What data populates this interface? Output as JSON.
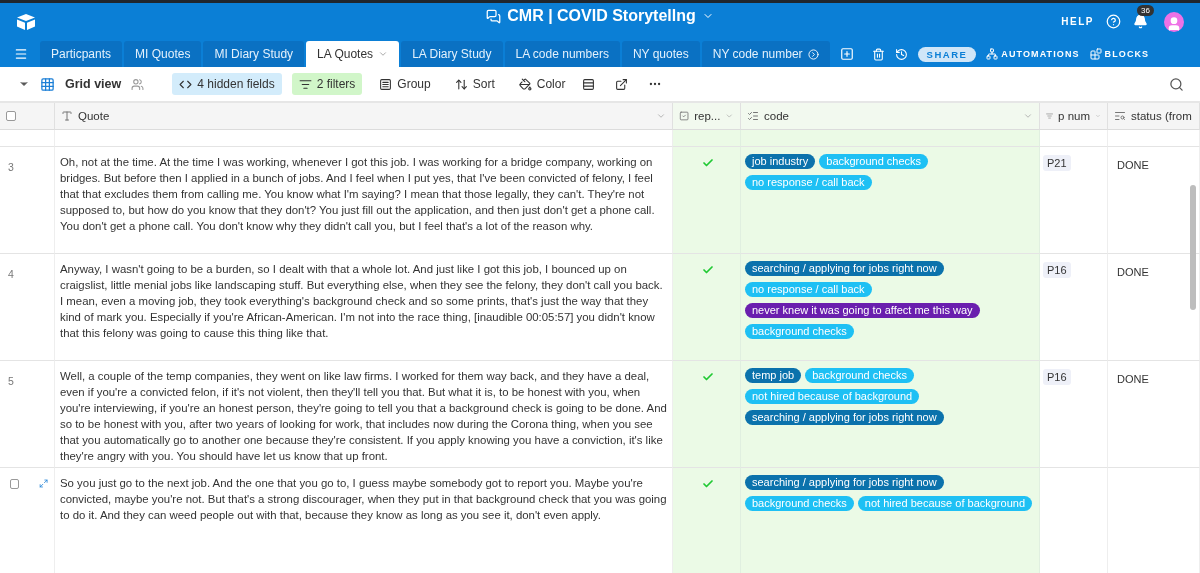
{
  "app_bar": {
    "title": "CMR | COVID Storytellng",
    "help": "HELP",
    "notifications": "36"
  },
  "tabs": [
    {
      "label": "Particpants",
      "selected": false
    },
    {
      "label": "MI Quotes",
      "selected": false
    },
    {
      "label": "MI Diary Study",
      "selected": false
    },
    {
      "label": "LA Quotes",
      "selected": true
    },
    {
      "label": "LA Diary Study",
      "selected": false
    },
    {
      "label": "LA code numbers",
      "selected": false
    },
    {
      "label": "NY quotes",
      "selected": false
    },
    {
      "label": "NY code number",
      "selected": false
    }
  ],
  "tab_actions": {
    "share": "SHARE",
    "automations": "AUTOMATIONS",
    "blocks": "BLOCKS"
  },
  "toolbar": {
    "view": "Grid view",
    "hidden_fields": "4 hidden fields",
    "filters": "2 filters",
    "group": "Group",
    "sort": "Sort",
    "color_label": "Color"
  },
  "table": {
    "select_all_checked": false,
    "columns": [
      {
        "label": "Quote",
        "kind": "text"
      },
      {
        "label": "rep...",
        "kind": "checkbox"
      },
      {
        "label": "code",
        "kind": "multi"
      },
      {
        "label": "p num",
        "kind": "link"
      },
      {
        "label": "status (from",
        "kind": "lookup"
      }
    ],
    "rows": [
      {
        "number": "3",
        "hovered": false,
        "quote": "Oh, not at the time. At the time I was working, whenever I got this job. I was working for a bridge company, working on bridges. But before then I applied in a bunch of jobs. And I feel when I put yes, that I've been convicted of felony, I feel that that excludes them from calling me. You know what I'm saying? I mean that those legally, they can't. They're not supposed to, but how do you know that they don't? You just fill out the application, and then just don't get a phone call. You don't get a phone call. You don't know why they didn't call you, but I feel that's a lot of the reason why.",
        "rep": true,
        "codes": [
          {
            "label": "job industry",
            "color": "#0b72ac"
          },
          {
            "label": "background checks",
            "color": "#1ec0f4"
          },
          {
            "label": "no response / call back",
            "color": "#1ec0f4"
          }
        ],
        "p_num": "P21",
        "status": "DONE"
      },
      {
        "number": "4",
        "hovered": false,
        "quote": "Anyway, I wasn't going to be a burden, so I dealt with that a whole lot. And just like I got this job, I bounced up on craigslist, little menial jobs like landscaping stuff. But everything else, when they see the felony, they don't call you back. I mean, even a moving job, they took everything's background check and so some prints, that's just the way that they kind of mark you. Especially if you're African-American. I'm not into the race thing, [inaudible 00:05:57] you didn't know that this felony was going to cause this thing like that.",
        "rep": true,
        "codes": [
          {
            "label": "searching / applying for jobs right now",
            "color": "#0b72ac"
          },
          {
            "label": "no response / call back",
            "color": "#1ec0f4"
          },
          {
            "label": "never knew it was going to affect me this way",
            "color": "#6a1fae"
          },
          {
            "label": "background checks",
            "color": "#1ec0f4"
          }
        ],
        "p_num": "P16",
        "status": "DONE"
      },
      {
        "number": "5",
        "hovered": false,
        "quote": "Well, a couple of the temp companies, they went on like law firms. I worked for them way back, and they have a deal, even if you're a convicted felon, if it's not violent, then they'll tell you that. But what it is, to be honest with you, when you're interviewing, if you're an honest person, they're going to tell you that a background check is going to be done. And so to be honest with you, after two years of looking for work, that includes now during the Corona thing, when you see that you automatically go to another one because they're consistent. If you apply knowing you have a conviction, it's like they're angry with you. You should have let us know that up front.",
        "rep": true,
        "codes": [
          {
            "label": "temp job",
            "color": "#0b72ac"
          },
          {
            "label": "background checks",
            "color": "#1ec0f4"
          },
          {
            "label": "not hired because of background",
            "color": "#1ec0f4"
          },
          {
            "label": "searching / applying for jobs right now",
            "color": "#0b72ac"
          }
        ],
        "p_num": "P16",
        "status": "DONE"
      },
      {
        "hovered": true,
        "checked": false,
        "quote": "So you just go to the next job. And the one that you go to, I guess maybe somebody got to report you. Maybe you're convicted, maybe you're not. But that's a strong discourager, when they put in that background check that you was going to do it. And they can weed people out with that, because they know as long as you see it, don't even apply.",
        "rep": true,
        "codes": [
          {
            "label": "searching / applying for jobs right now",
            "color": "#0b72ac"
          },
          {
            "label": "background checks",
            "color": "#1ec0f4"
          },
          {
            "label": "not hired because of background",
            "color": "#1ec0f4"
          }
        ]
      }
    ]
  }
}
